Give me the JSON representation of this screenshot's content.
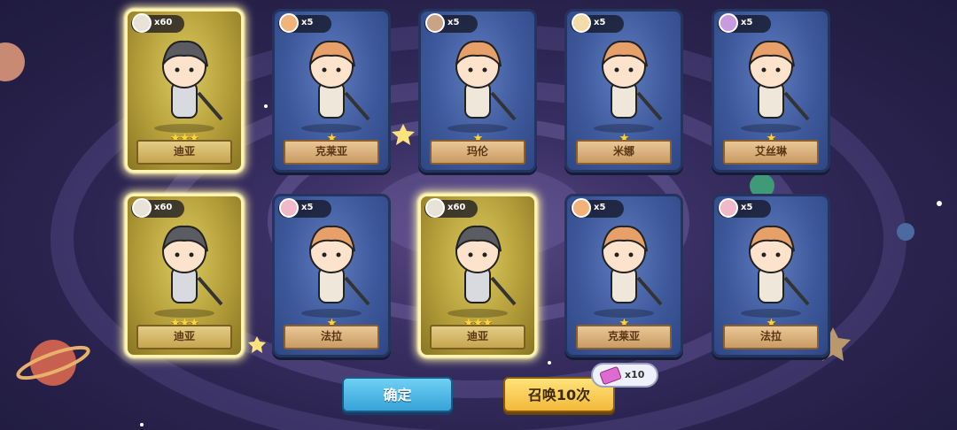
{
  "cards": [
    {
      "name": "迪亚",
      "count": "x60",
      "stars": "★★★",
      "rarity": "gold",
      "thumb": "gray"
    },
    {
      "name": "克莱亚",
      "count": "x5",
      "stars": "★",
      "rarity": "blue",
      "thumb": "orange"
    },
    {
      "name": "玛伦",
      "count": "x5",
      "stars": "★",
      "rarity": "blue",
      "thumb": "brown"
    },
    {
      "name": "米娜",
      "count": "x5",
      "stars": "★",
      "rarity": "blue",
      "thumb": "blonde"
    },
    {
      "name": "艾丝琳",
      "count": "x5",
      "stars": "★",
      "rarity": "blue",
      "thumb": "purple"
    },
    {
      "name": "迪亚",
      "count": "x60",
      "stars": "★★★",
      "rarity": "gold",
      "thumb": "gray"
    },
    {
      "name": "法拉",
      "count": "x5",
      "stars": "★",
      "rarity": "blue",
      "thumb": "pink"
    },
    {
      "name": "迪亚",
      "count": "x60",
      "stars": "★★★",
      "rarity": "gold",
      "thumb": "gray"
    },
    {
      "name": "克莱亚",
      "count": "x5",
      "stars": "★",
      "rarity": "blue",
      "thumb": "orange"
    },
    {
      "name": "法拉",
      "count": "x5",
      "stars": "★",
      "rarity": "blue",
      "thumb": "pink"
    }
  ],
  "buttons": {
    "confirm": "确定",
    "summon10": "召唤10次"
  },
  "cost": {
    "icon": "summon-ticket-icon",
    "count": "x10"
  }
}
